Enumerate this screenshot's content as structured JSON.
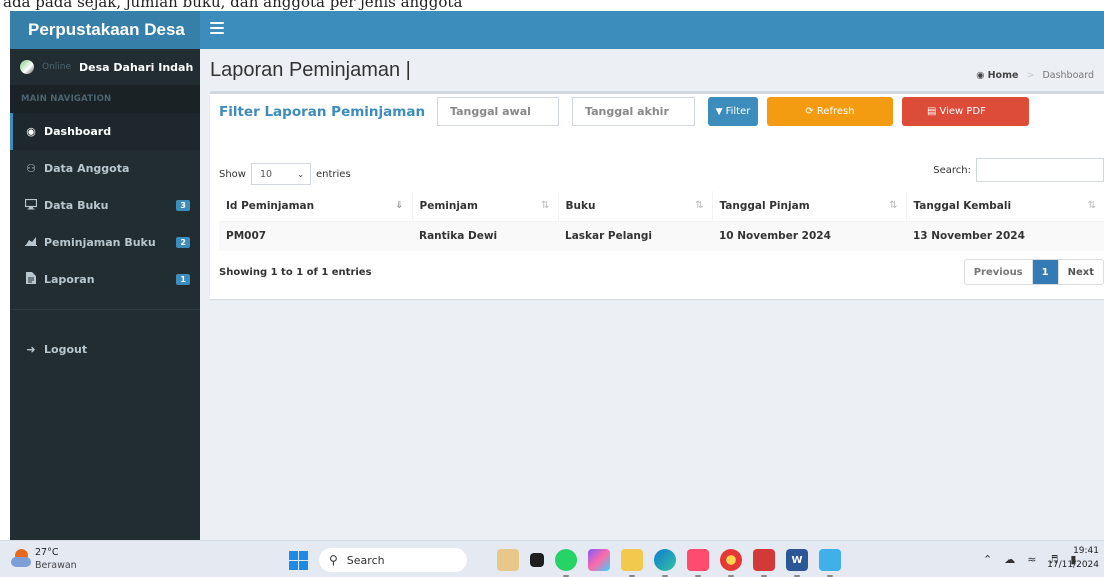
{
  "doc_strip": "ada pada sejak, jumlah buku, dan anggota per jenis anggota",
  "brand": {
    "title": "Perpustakaan Desa"
  },
  "user_panel": {
    "name": "Desa Dahari Indah",
    "status": "Online"
  },
  "sidebar": {
    "header": "MAIN NAVIGATION",
    "items": [
      {
        "label": "Dashboard",
        "icon": "dashboard-icon",
        "badge": "",
        "active": true
      },
      {
        "label": "Data Anggota",
        "icon": "users-icon",
        "badge": ""
      },
      {
        "label": "Data Buku",
        "icon": "desktop-icon",
        "badge": "3"
      },
      {
        "label": "Peminjaman Buku",
        "icon": "chart-icon",
        "badge": "2"
      },
      {
        "label": "Laporan",
        "icon": "file-icon",
        "badge": "1"
      }
    ],
    "logout": "Logout"
  },
  "content": {
    "title": "Laporan Peminjaman |",
    "breadcrumb": {
      "home": "Home",
      "current": "Dashboard"
    }
  },
  "filter": {
    "title": "Filter Laporan Peminjaman",
    "start_placeholder": "Tanggal awal",
    "end_placeholder": "Tanggal akhir",
    "filter_label": "Filter",
    "refresh_label": "Refresh",
    "pdf_label": "View PDF"
  },
  "datatable": {
    "show_label": "Show",
    "entries_value": "10",
    "entries_label": "entries",
    "search_label": "Search:",
    "columns": [
      "Id Peminjaman",
      "Peminjam",
      "Buku",
      "Tanggal Pinjam",
      "Tanggal Kembali"
    ],
    "rows": [
      [
        "PM007",
        "Rantika Dewi",
        "Laskar Pelangi",
        "10 November 2024",
        "13 November 2024"
      ]
    ],
    "info": "Showing 1 to 1 of 1 entries",
    "pagination": {
      "previous": "Previous",
      "current": "1",
      "next": "Next"
    }
  },
  "taskbar": {
    "temperature": "27°C",
    "weather": "Berawan",
    "search_placeholder": "Search",
    "time": "19:41",
    "date": "17/11/2024"
  },
  "colors": {
    "primary": "#3c8dbc",
    "sidebar": "#222d32",
    "warning": "#f39c12",
    "danger": "#dd4b39"
  }
}
